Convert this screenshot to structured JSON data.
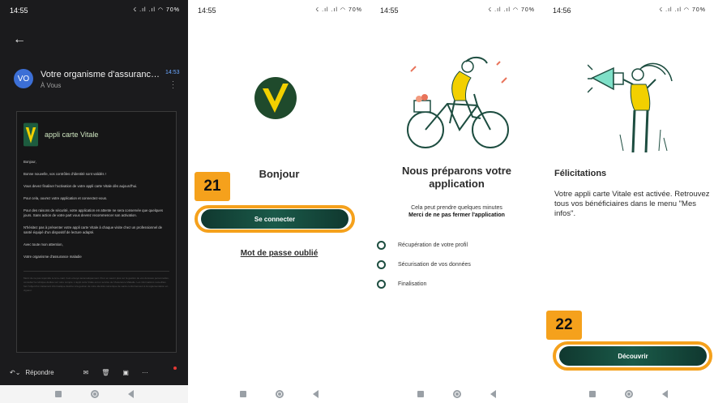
{
  "phone1": {
    "status": {
      "time": "14:55",
      "icons": "☇ .ıl .ıl ◠ 70%"
    },
    "email": {
      "avatar": "VO",
      "sender": "Votre organisme d'assurance ma...",
      "recipient": "À Vous",
      "time": "14:53",
      "app_name": "appli carte Vitale",
      "greeting": "Bonjour,",
      "p1": "Bonne nouvelle, vos contrôles d'identité sont validés !",
      "p2": "Vous devez finaliser l'activation de votre appli carte Vitale dès aujourd'hui.",
      "p3": "Pour cela, ouvrez votre application et connectez-vous.",
      "p4": "Pour des raisons de sécurité, votre application en attente ne sera conservée que quelques jours. Sans action de votre part vous devrez recommencer son activation.",
      "p5": "N'hésitez pas à présenter votre appli carte Vitale à chaque visite chez un professionnel de santé équipé d'un dispositif de lecture adapté.",
      "closing": "Avec toute mon attention,",
      "signature": "Votre organisme d'assurance maladie",
      "fine_print": "Merci de ne pas répondre à cet e-mail, il est envoyé automatiquement. Pour en savoir plus sur la gestion de vos données personnelles, consultez la rubrique dédiée sur votre compte. L'appli carte Vitale est un service de l'Assurance Maladie. Les informations recueillies font l'objet d'un traitement informatique destiné à la gestion de votre identité numérique de santé conformément à la réglementation en vigueur."
    },
    "reply_label": "Répondre"
  },
  "phone2": {
    "status": {
      "time": "14:55",
      "icons": "☇ .ıl .ıl ◠ 70%"
    },
    "title": "Bonjour",
    "badge": "21",
    "button": "Se connecter",
    "link": "Mot de passe oublié"
  },
  "phone3": {
    "status": {
      "time": "14:55",
      "icons": "☇ .ıl .ıl ◠ 70%"
    },
    "title_line1": "Nous préparons votre",
    "title_line2": "application",
    "sub1": "Cela peut prendre quelques minutes",
    "sub2": "Merci de ne pas fermer l'application",
    "steps": [
      "Récupération de votre profil",
      "Sécurisation de vos données",
      "Finalisation"
    ]
  },
  "phone4": {
    "status": {
      "time": "14:56",
      "icons": "☇ .ıl .ıl ◠ 70%"
    },
    "title": "Félicitations",
    "text": "Votre appli carte Vitale est activée. Retrouvez tous vos bénéficiaires dans le menu \"Mes infos\".",
    "badge": "22",
    "button": "Découvrir"
  },
  "colors": {
    "accent": "#f5a11c",
    "brand_dark": "#10382f",
    "vitale_yellow": "#f2d000"
  }
}
